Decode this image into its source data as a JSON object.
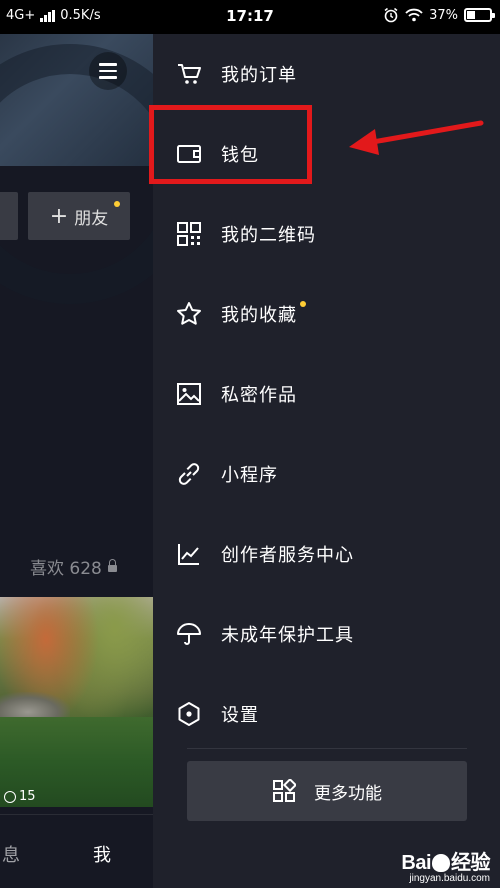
{
  "status_bar": {
    "network": "4G+",
    "speed": "0.5K/s",
    "time": "17:17",
    "battery": "37%",
    "battery_level": 0.37
  },
  "profile_bg": {
    "add_friend_label": "朋友",
    "likes_tab": "喜欢 628",
    "play_count": "15",
    "nav_messages": "息",
    "nav_me": "我"
  },
  "drawer": {
    "items": [
      {
        "label": "我的订单",
        "icon": "cart-icon"
      },
      {
        "label": "钱包",
        "icon": "wallet-icon"
      },
      {
        "label": "我的二维码",
        "icon": "qr-code-icon"
      },
      {
        "label": "我的收藏",
        "icon": "star-icon",
        "dot": true
      },
      {
        "label": "私密作品",
        "icon": "image-icon"
      },
      {
        "label": "小程序",
        "icon": "link-icon"
      },
      {
        "label": "创作者服务中心",
        "icon": "chart-icon"
      },
      {
        "label": "未成年保护工具",
        "icon": "umbrella-icon"
      },
      {
        "label": "设置",
        "icon": "hexagon-settings-icon"
      }
    ],
    "more_button": "更多功能"
  },
  "annotation": {
    "highlight_color": "#e2191b"
  },
  "watermark": {
    "logo_left": "Bai",
    "logo_right": "经验",
    "sub": "jingyan.baidu.com"
  },
  "colors": {
    "drawer_bg": "#1f212b",
    "accent_dot": "#fecd35"
  }
}
